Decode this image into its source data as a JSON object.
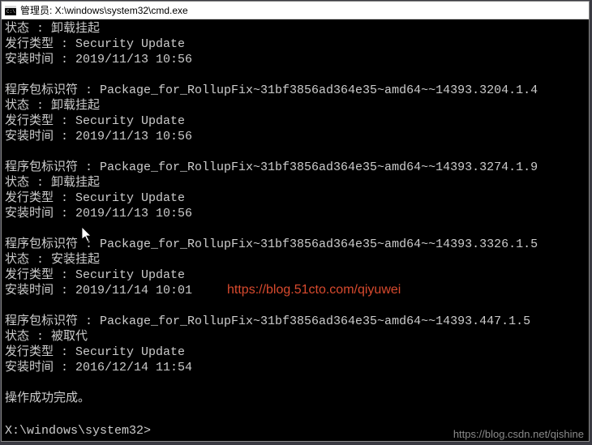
{
  "titlebar": {
    "icon": "cmd-icon",
    "text": "管理员: X:\\windows\\system32\\cmd.exe"
  },
  "terminal_lines": [
    "状态 : 卸载挂起",
    "发行类型 : Security Update",
    "安装时间 : 2019/11/13 10:56",
    "",
    "程序包标识符 : Package_for_RollupFix~31bf3856ad364e35~amd64~~14393.3204.1.4",
    "状态 : 卸载挂起",
    "发行类型 : Security Update",
    "安装时间 : 2019/11/13 10:56",
    "",
    "程序包标识符 : Package_for_RollupFix~31bf3856ad364e35~amd64~~14393.3274.1.9",
    "状态 : 卸载挂起",
    "发行类型 : Security Update",
    "安装时间 : 2019/11/13 10:56",
    "",
    "程序包标识符 : Package_for_RollupFix~31bf3856ad364e35~amd64~~14393.3326.1.5",
    "状态 : 安装挂起",
    "发行类型 : Security Update",
    "安装时间 : 2019/11/14 10:01",
    "",
    "程序包标识符 : Package_for_RollupFix~31bf3856ad364e35~amd64~~14393.447.1.5",
    "状态 : 被取代",
    "发行类型 : Security Update",
    "安装时间 : 2016/12/14 11:54",
    "",
    "操作成功完成。",
    ""
  ],
  "prompt": "X:\\windows\\system32>",
  "watermarks": {
    "center": "https://blog.51cto.com/qiyuwei",
    "bottom": "https://blog.csdn.net/qishine"
  }
}
